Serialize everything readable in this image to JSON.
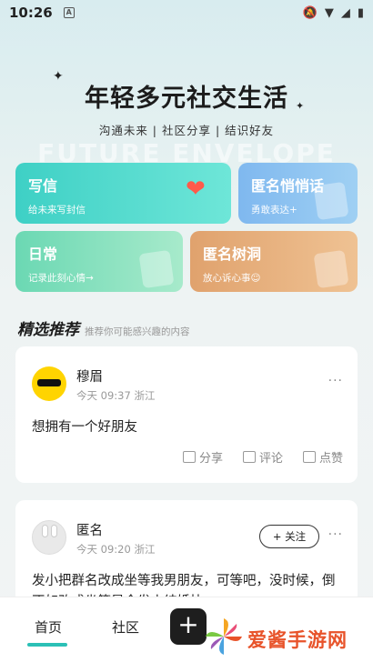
{
  "status": {
    "time": "10:26",
    "a_icon": "A"
  },
  "hero": {
    "title": "年轻多元社交生活",
    "subtitle": "沟通未来 | 社区分享 | 结识好友",
    "watermark": "FUTURE ENVELOPE"
  },
  "cards": [
    {
      "title": "写信",
      "sub": "给未来写封信"
    },
    {
      "title": "匿名悄悄话",
      "sub": "勇敢表达+"
    },
    {
      "title": "日常",
      "sub": "记录此刻心情→"
    },
    {
      "title": "匿名树洞",
      "sub": "放心诉心事☺"
    }
  ],
  "section": {
    "title": "精选推荐",
    "hint": "推荐你可能感兴趣的内容"
  },
  "posts": [
    {
      "name": "穆眉",
      "meta": "今天 09:37 浙江",
      "content": "想拥有一个好朋友",
      "share": "分享",
      "comment": "评论",
      "like": "点赞",
      "more": "···"
    },
    {
      "name": "匿名",
      "meta": "今天 09:20 浙江",
      "follow": "+ 关注",
      "content": "发小把群名改成坐等我男朋友，可等吧，没时候，倒不如改成坐等是今发小结婚快",
      "more": "···"
    }
  ],
  "nav": {
    "home": "首页",
    "community": "社区",
    "add": "+"
  },
  "watermark_logo": "爱酱手游网"
}
